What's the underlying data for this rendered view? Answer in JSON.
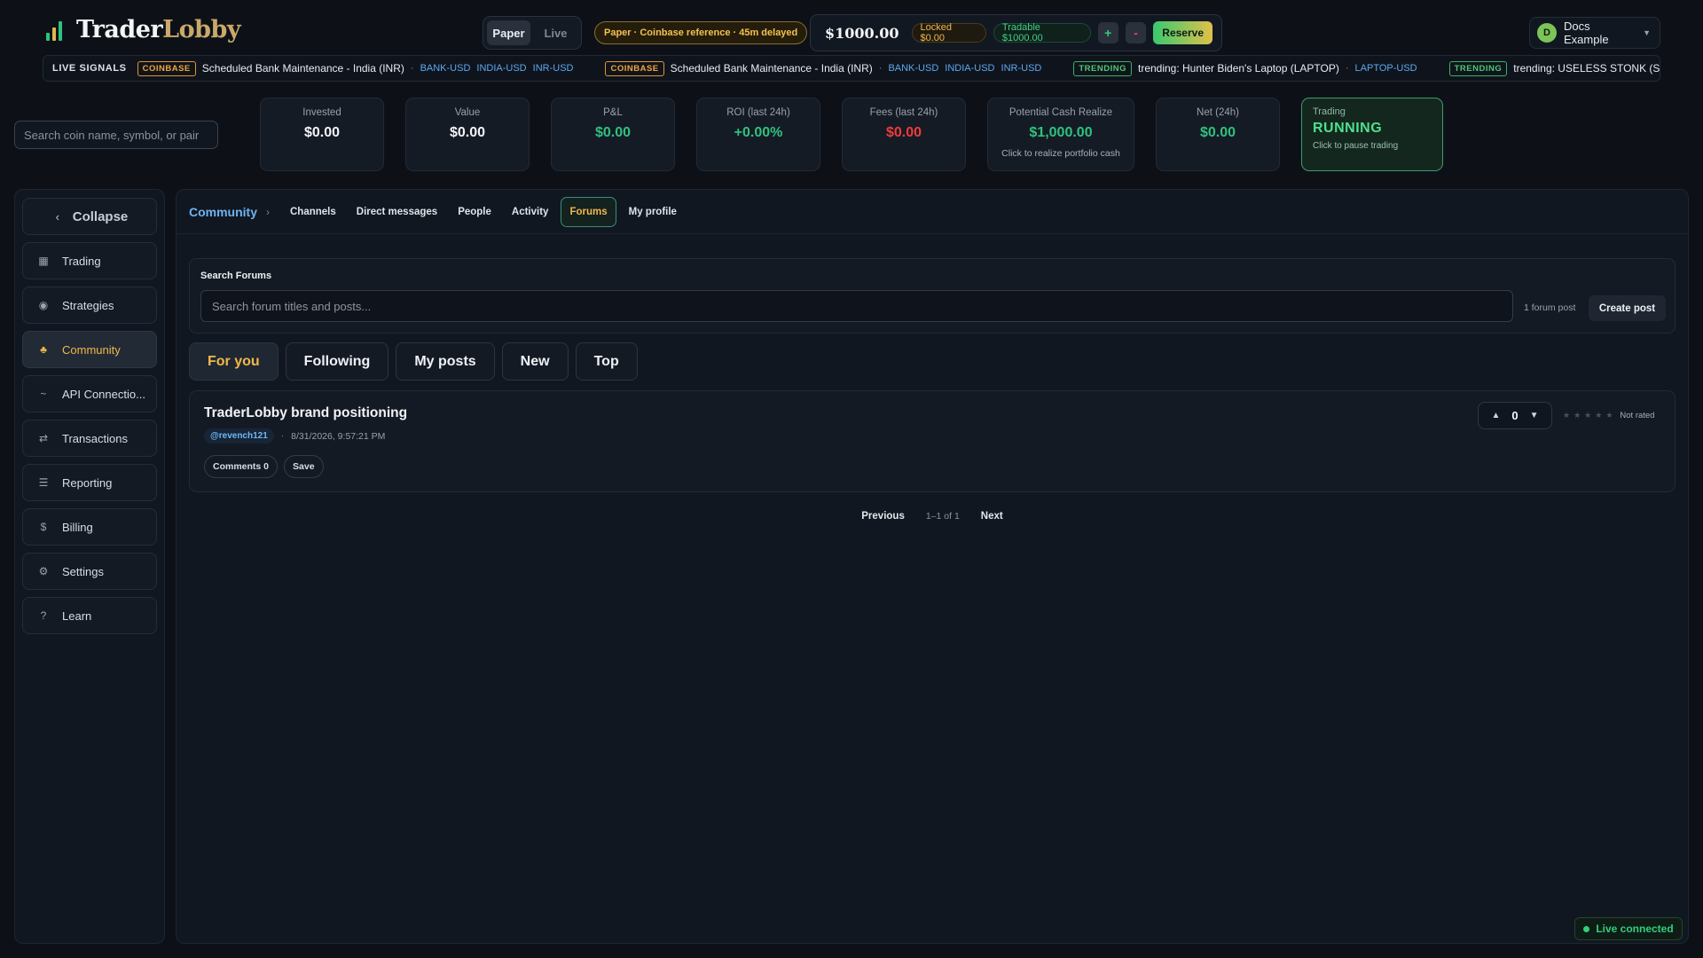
{
  "header": {
    "brand_part1": "Trader",
    "brand_part2": "Lobby",
    "mode_paper": "Paper",
    "mode_live": "Live",
    "reference": "Paper · Coinbase reference · 45m delayed",
    "balance": "$1000.00",
    "locked": "Locked $0.00",
    "tradable": "Tradable $1000.00",
    "plus_label": "+",
    "minus_label": "-",
    "reserve_label": "Reserve",
    "user_initial": "D",
    "user_name": "Docs Example",
    "colors": {
      "accent_gold": "#c9a86a",
      "green": "#2ec27e",
      "red": "#ef3b3b"
    }
  },
  "ticker": {
    "label": "LIVE SIGNALS",
    "items": [
      {
        "badge": "COINBASE",
        "text": "Scheduled Bank Maintenance - India (INR)",
        "symbols": [
          "BANK-USD",
          "INDIA-USD",
          "INR-USD"
        ]
      },
      {
        "badge": "COINBASE",
        "text": "Scheduled Bank Maintenance - India (INR)",
        "symbols": [
          "BANK-USD",
          "INDIA-USD",
          "INR-USD"
        ]
      },
      {
        "badge": "TRENDING",
        "text": "trending: Hunter Biden's Laptop (LAPTOP)",
        "symbols": [
          "LAPTOP-USD"
        ]
      },
      {
        "badge": "TRENDING",
        "text": "trending: USELESS STONK (STONK"
      }
    ]
  },
  "coin_search": {
    "placeholder": "Search coin name, symbol, or pair"
  },
  "stats": {
    "invested": {
      "label": "Invested",
      "value": "$0.00"
    },
    "value": {
      "label": "Value",
      "value": "$0.00"
    },
    "pnl": {
      "label": "P&L",
      "value": "$0.00"
    },
    "roi": {
      "label": "ROI (last 24h)",
      "value": "+0.00%"
    },
    "fees": {
      "label": "Fees (last 24h)",
      "value": "$0.00"
    },
    "cash": {
      "label": "Potential Cash Realize",
      "value": "$1,000.00",
      "sub": "Click to realize portfolio cash"
    },
    "net": {
      "label": "Net (24h)",
      "value": "$0.00"
    },
    "trading": {
      "label": "Trading",
      "value": "RUNNING",
      "sub": "Click to pause trading"
    }
  },
  "sidebar": {
    "collapse_label": "Collapse",
    "items": [
      {
        "label": "Trading",
        "icon": "grid-icon"
      },
      {
        "label": "Strategies",
        "icon": "strategy-icon"
      },
      {
        "label": "Community",
        "icon": "community-icon"
      },
      {
        "label": "API Connectio...",
        "icon": "api-icon"
      },
      {
        "label": "Transactions",
        "icon": "transfer-icon"
      },
      {
        "label": "Reporting",
        "icon": "report-icon"
      },
      {
        "label": "Billing",
        "icon": "dollar-icon"
      },
      {
        "label": "Settings",
        "icon": "gear-icon"
      },
      {
        "label": "Learn",
        "icon": "question-icon"
      }
    ]
  },
  "community": {
    "breadcrumb": "Community",
    "tabs": [
      "Channels",
      "Direct messages",
      "People",
      "Activity",
      "Forums",
      "My profile"
    ],
    "search_title": "Search Forums",
    "search_placeholder": "Search forum titles and posts...",
    "post_count": "1 forum post",
    "create_label": "Create post",
    "filters": [
      "For you",
      "Following",
      "My posts",
      "New",
      "Top"
    ],
    "post": {
      "title": "TraderLobby brand positioning",
      "author": "@revench121",
      "date": "8/31/2026, 9:57:21 PM",
      "comments_label": "Comments 0",
      "save_label": "Save",
      "votes": "0",
      "rating_label": "Not rated"
    },
    "pager": {
      "prev": "Previous",
      "info": "1–1 of 1",
      "next": "Next"
    }
  },
  "status": {
    "live": "Live connected"
  }
}
